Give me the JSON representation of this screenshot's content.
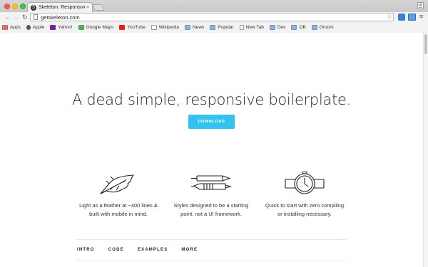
{
  "browser": {
    "tab_title": "Skeleton: Responsive CSS",
    "tab_close": "×",
    "favicon_letter": "S",
    "url": "getskeleton.com",
    "bookmarks": [
      {
        "label": "Apps",
        "icon": "apps-icon"
      },
      {
        "label": "Apple",
        "icon": "apple-icon"
      },
      {
        "label": "Yahoo!",
        "icon": "yahoo-icon"
      },
      {
        "label": "Google Maps",
        "icon": "maps-icon"
      },
      {
        "label": "YouTube",
        "icon": "youtube-icon"
      },
      {
        "label": "Wikipedia",
        "icon": "wikipedia-icon"
      },
      {
        "label": "News",
        "icon": "folder-icon"
      },
      {
        "label": "Popular",
        "icon": "folder-icon"
      },
      {
        "label": "New Tab",
        "icon": "page-icon"
      },
      {
        "label": "Dev",
        "icon": "folder-icon"
      },
      {
        "label": "OB",
        "icon": "folder-icon"
      },
      {
        "label": "Groom",
        "icon": "folder-icon"
      }
    ]
  },
  "page": {
    "headline": "A dead simple, responsive boilerplate.",
    "download_label": "DOWNLOAD",
    "features": [
      {
        "icon": "feather-icon",
        "line1": "Light as a feather at ~400 lines &",
        "line2": "built with mobile in mind."
      },
      {
        "icon": "pen-icon",
        "line1": "Styles designed to be a starting",
        "line2": "point, not a UI framework."
      },
      {
        "icon": "watch-icon",
        "line1": "Quick to start with zero compiling",
        "line2": "or installing necessary."
      }
    ],
    "subnav": [
      "INTRO",
      "CODE",
      "EXAMPLES",
      "MORE"
    ]
  },
  "colors": {
    "accent": "#33c3f0"
  }
}
